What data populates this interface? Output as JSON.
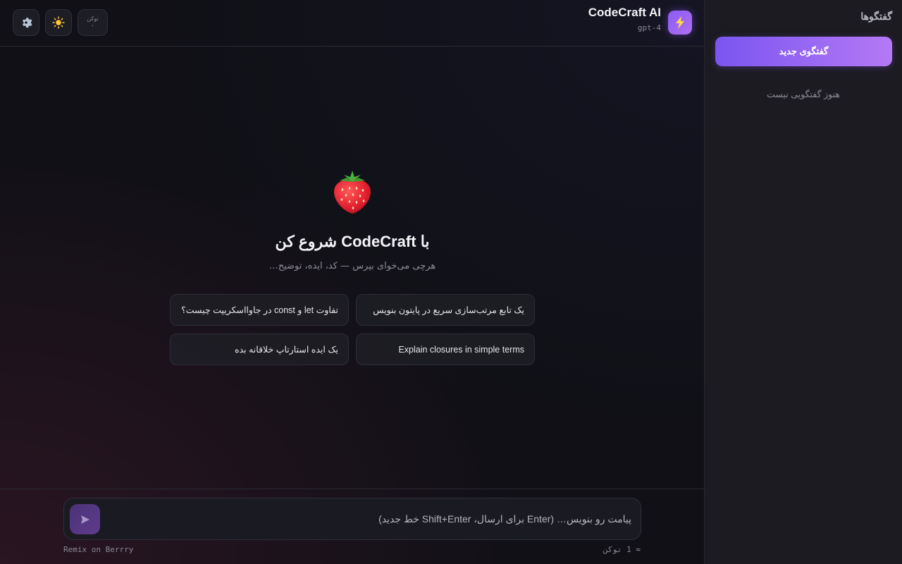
{
  "header": {
    "settings_icon": "gear-icon",
    "theme_icon": "sun-icon",
    "token_label": "توکن",
    "token_value": "۰",
    "brand_name": "CodeCraft AI",
    "model": "gpt-4",
    "brand_icon": "lightning-icon"
  },
  "hero": {
    "emoji": "strawberry-icon",
    "title": "با CodeCraft شروع کن",
    "subtitle": "هرچی می‌خوای بپرس — کد، ایده، توضیح…"
  },
  "suggestions": [
    "یک تابع مرتب‌سازی سریع در پایتون بنویس",
    "تفاوت let و const در جاوااسکریپت چیست؟",
    "Explain closures in simple terms",
    "یک ایده استارتاپ خلاقانه بده"
  ],
  "composer": {
    "placeholder": "پیامت رو بنویس… (Enter برای ارسال، Shift+Enter خط جدید)",
    "send_icon": "send-icon"
  },
  "footer": {
    "credit": "Remix on Berrry",
    "token_estimate": "≈ 1 توکن"
  },
  "sidebar": {
    "title": "گفتگوها",
    "new_chat": "گفتگوی جدید",
    "empty": "هنوز گفتگویی نیست"
  },
  "colors": {
    "accent": "#8a5cf6",
    "accent_light": "#b479f5",
    "background": "#101016",
    "sidebar": "#1b1b21"
  }
}
